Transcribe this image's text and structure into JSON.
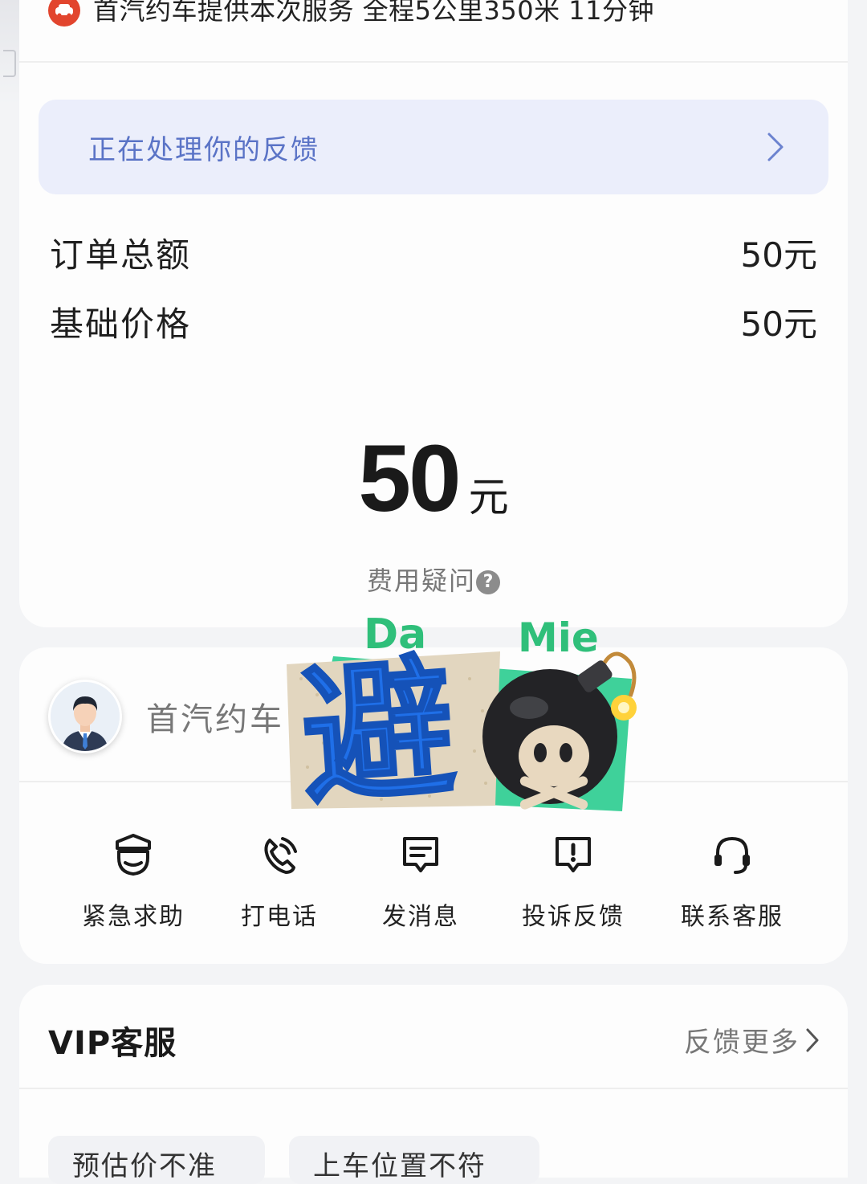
{
  "trip": {
    "service_text": "首汽约车提供本次服务 全程5公里350米 11分钟",
    "provider_icon": "car-icon"
  },
  "feedback_banner": {
    "label": "正在处理你的反馈",
    "icon": "chevron-right-icon"
  },
  "fare": {
    "rows": [
      {
        "label": "订单总额",
        "value": "50元"
      },
      {
        "label": "基础价格",
        "value": "50元"
      }
    ],
    "total_amount": "50",
    "total_unit": "元",
    "fee_question": "费用疑问",
    "fee_question_icon": "question-circle-icon"
  },
  "driver": {
    "name": "首汽约车",
    "avatar_icon": "driver-avatar-icon"
  },
  "actions": [
    {
      "label": "紧急求助",
      "icon": "police-badge-icon"
    },
    {
      "label": "打电话",
      "icon": "phone-icon"
    },
    {
      "label": "发消息",
      "icon": "message-icon"
    },
    {
      "label": "投诉反馈",
      "icon": "complaint-icon"
    },
    {
      "label": "联系客服",
      "icon": "headset-icon"
    }
  ],
  "sticker": {
    "left_text": "Da",
    "right_text": "Mie",
    "main_char": "避",
    "bomb_icon": "skull-bomb-icon",
    "colors": {
      "green": "#2fbf7a",
      "blue": "#1f6fe8",
      "mint": "#3fd19a"
    }
  },
  "vip": {
    "title": "VIP客服",
    "more_label": "反馈更多",
    "chips": [
      "预估价不准",
      "上车位置不符"
    ]
  },
  "colors": {
    "accent_blue": "#5a73c6",
    "banner_bg": "#ebeefb",
    "card_bg": "#fdfdfd",
    "page_bg": "#f3f4f6"
  }
}
